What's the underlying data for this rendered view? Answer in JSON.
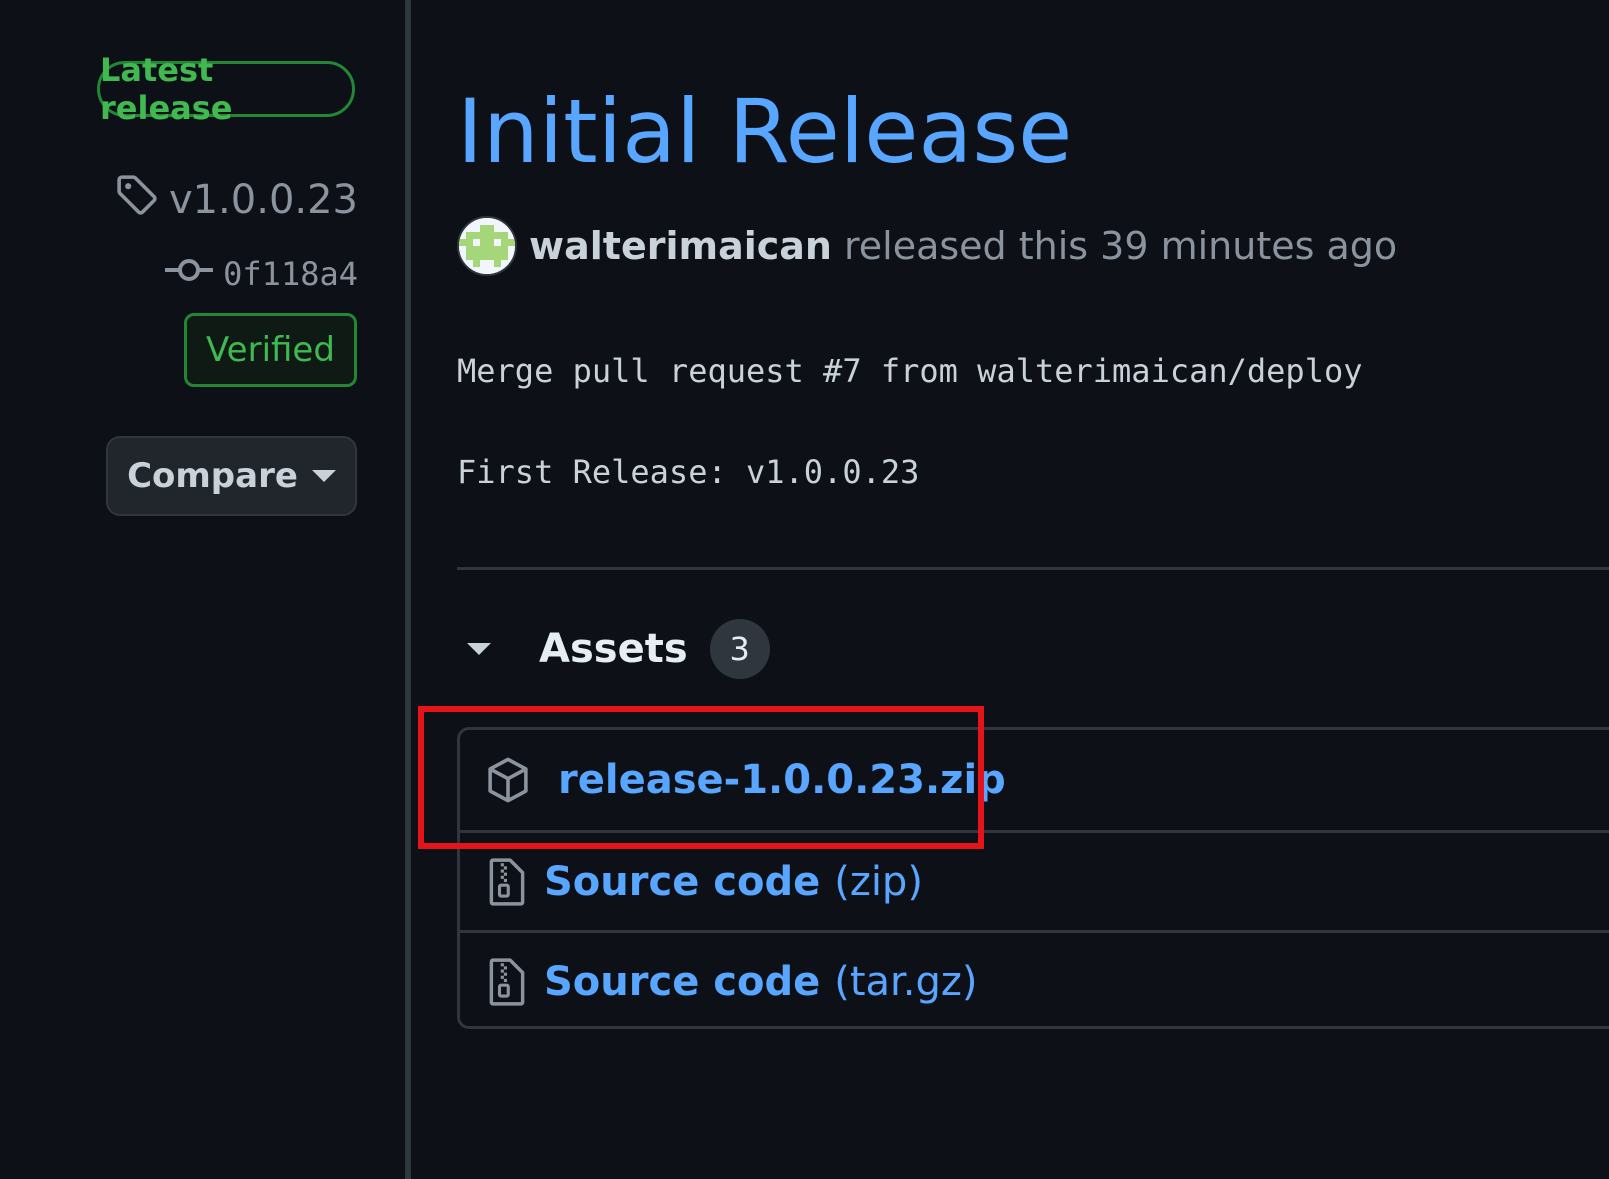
{
  "sidebar": {
    "latest_badge": "Latest release",
    "tag": "v1.0.0.23",
    "commit": "0f118a4",
    "verified": "Verified",
    "compare": "Compare"
  },
  "release": {
    "title": "Initial Release",
    "author": "walterimaican",
    "released_text": "released this 39 minutes ago",
    "body_lines": [
      "Merge pull request #7 from walterimaican/deploy",
      "First Release: v1.0.0.23"
    ]
  },
  "assets": {
    "label": "Assets",
    "count": "3",
    "items": [
      {
        "name": "release-1.0.0.23.zip",
        "suffix": "",
        "icon": "package-icon"
      },
      {
        "name": "Source code",
        "suffix": "(zip)",
        "icon": "file-zip-icon"
      },
      {
        "name": "Source code",
        "suffix": "(tar.gz)",
        "icon": "file-zip-icon"
      }
    ]
  },
  "colors": {
    "background": "#0d1117",
    "link": "#58a6ff",
    "success": "#3fb950",
    "highlight": "#e5141b"
  }
}
